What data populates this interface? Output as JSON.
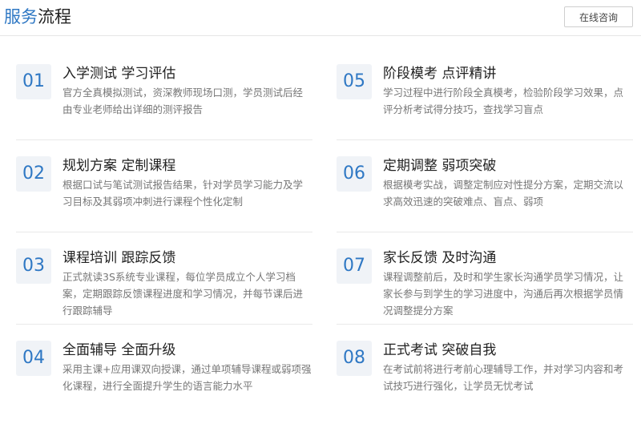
{
  "header": {
    "title_accent": "服务",
    "title_rest": "流程",
    "consult_label": "在线咨询"
  },
  "steps": [
    {
      "num": "01",
      "title": "入学测试 学习评估",
      "desc": "官方全真模拟测试，资深教师现场口测，学员测试后经由专业老师给出详细的测评报告"
    },
    {
      "num": "02",
      "title": "规划方案 定制课程",
      "desc": "根据口试与笔试测试报告结果，针对学员学习能力及学习目标及其弱项冲刺进行课程个性化定制"
    },
    {
      "num": "03",
      "title": "课程培训 跟踪反馈",
      "desc": "正式就读3S系统专业课程，每位学员成立个人学习档案，定期跟踪反馈课程进度和学习情况，并每节课后进行跟踪辅导"
    },
    {
      "num": "04",
      "title": "全面辅导 全面升级",
      "desc": "采用主课+应用课双向授课，通过单项辅导课程或弱项强化课程，进行全面提升学生的语言能力水平"
    },
    {
      "num": "05",
      "title": "阶段模考 点评精讲",
      "desc": "学习过程中进行阶段全真模考，检验阶段学习效果，点评分析考试得分技巧，查找学习盲点"
    },
    {
      "num": "06",
      "title": "定期调整 弱项突破",
      "desc": "根据模考实战，调整定制应对性提分方案，定期交流以求高效迅速的突破难点、盲点、弱项"
    },
    {
      "num": "07",
      "title": "家长反馈 及时沟通",
      "desc": "课程调整前后，及时和学生家长沟通学员学习情况，让家长参与到学生的学习进度中，沟通后再次根据学员情况调整提分方案"
    },
    {
      "num": "08",
      "title": "正式考试 突破自我",
      "desc": "在考试前将进行考前心理辅导工作，并对学习内容和考试技巧进行强化，让学员无忧考试"
    }
  ]
}
